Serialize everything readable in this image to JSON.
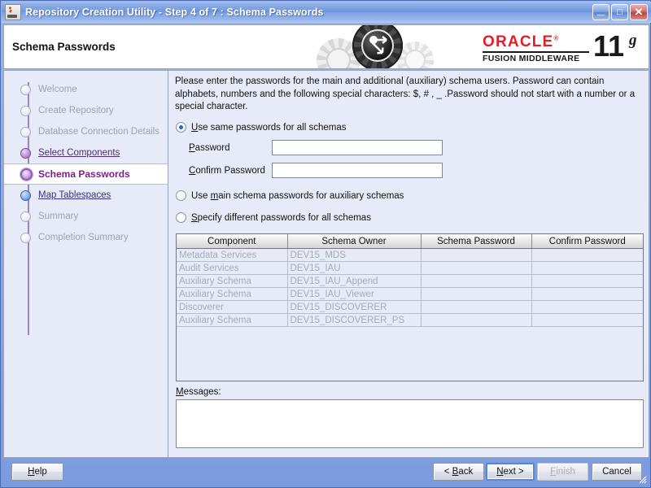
{
  "window": {
    "title": "Repository Creation Utility - Step 4 of 7 : Schema Passwords",
    "icon": "java-coffee-cup-icon",
    "minimize_label": "_",
    "maximize_label": "□",
    "close_label": "✕"
  },
  "header": {
    "page_title": "Schema Passwords",
    "brand": {
      "oracle": "ORACLE",
      "registered": "®",
      "product_line": "FUSION MIDDLEWARE",
      "version_number": "11",
      "version_suffix": "g"
    }
  },
  "sidebar": {
    "items": [
      {
        "label": "Welcome",
        "state": "pending"
      },
      {
        "label": "Create Repository",
        "state": "pending"
      },
      {
        "label": "Database Connection Details",
        "state": "pending"
      },
      {
        "label": "Select Components",
        "state": "done"
      },
      {
        "label": "Schema Passwords",
        "state": "current"
      },
      {
        "label": "Map Tablespaces",
        "state": "next"
      },
      {
        "label": "Summary",
        "state": "pending"
      },
      {
        "label": "Completion Summary",
        "state": "pending"
      }
    ]
  },
  "main": {
    "instructions": "Please enter the passwords for the main and additional (auxiliary) schema users. Password can contain alphabets, numbers and the following special characters: $, # , _ .Password should not start with a number or a special character.",
    "options": [
      {
        "label_pre": "",
        "mnemonic": "U",
        "label_post": "se same passwords for all schemas",
        "selected": true
      },
      {
        "label_pre": "Use ",
        "mnemonic": "m",
        "label_post": "ain schema passwords for auxiliary schemas",
        "selected": false
      },
      {
        "label_pre": "",
        "mnemonic": "S",
        "label_post": "pecify different passwords for all schemas",
        "selected": false
      }
    ],
    "password_field": {
      "mnemonic": "P",
      "label_post": "assword",
      "value": "",
      "placeholder": ""
    },
    "confirm_field": {
      "mnemonic": "C",
      "label_post": "onfirm Password",
      "value": "",
      "placeholder": ""
    },
    "table": {
      "columns": [
        "Component",
        "Schema Owner",
        "Schema Password",
        "Confirm Password"
      ],
      "rows": [
        {
          "component": "Metadata Services",
          "owner": "DEV15_MDS",
          "password": "",
          "confirm": "",
          "indent": false
        },
        {
          "component": "Audit Services",
          "owner": "DEV15_IAU",
          "password": "",
          "confirm": "",
          "indent": false
        },
        {
          "component": "Auxiliary Schema",
          "owner": "DEV15_IAU_Append",
          "password": "",
          "confirm": "",
          "indent": true
        },
        {
          "component": "Auxiliary Schema",
          "owner": "DEV15_IAU_Viewer",
          "password": "",
          "confirm": "",
          "indent": true
        },
        {
          "component": "Discoverer",
          "owner": "DEV15_DISCOVERER",
          "password": "",
          "confirm": "",
          "indent": false
        },
        {
          "component": "Auxiliary Schema",
          "owner": "DEV15_DISCOVERER_PS",
          "password": "",
          "confirm": "",
          "indent": true
        }
      ]
    },
    "messages": {
      "mnemonic": "M",
      "label_post": "essages:",
      "value": ""
    }
  },
  "footer": {
    "help": {
      "mnemonic": "H",
      "label_post": "elp"
    },
    "back": {
      "label_pre": "< ",
      "mnemonic": "B",
      "label_post": "ack"
    },
    "next": {
      "mnemonic": "N",
      "label_post": "ext >"
    },
    "finish": {
      "mnemonic": "F",
      "label_post": "inish",
      "disabled": true
    },
    "cancel": {
      "label_pre": "Cancel",
      "mnemonic": "",
      "label_post": ""
    }
  },
  "colors": {
    "accent_blue": "#7c9bdf",
    "oracle_red": "#e21e26",
    "current_step_purple": "#7b1f86",
    "link_purple": "#4c2c7a",
    "panel_bg": "#e6ebf7"
  }
}
